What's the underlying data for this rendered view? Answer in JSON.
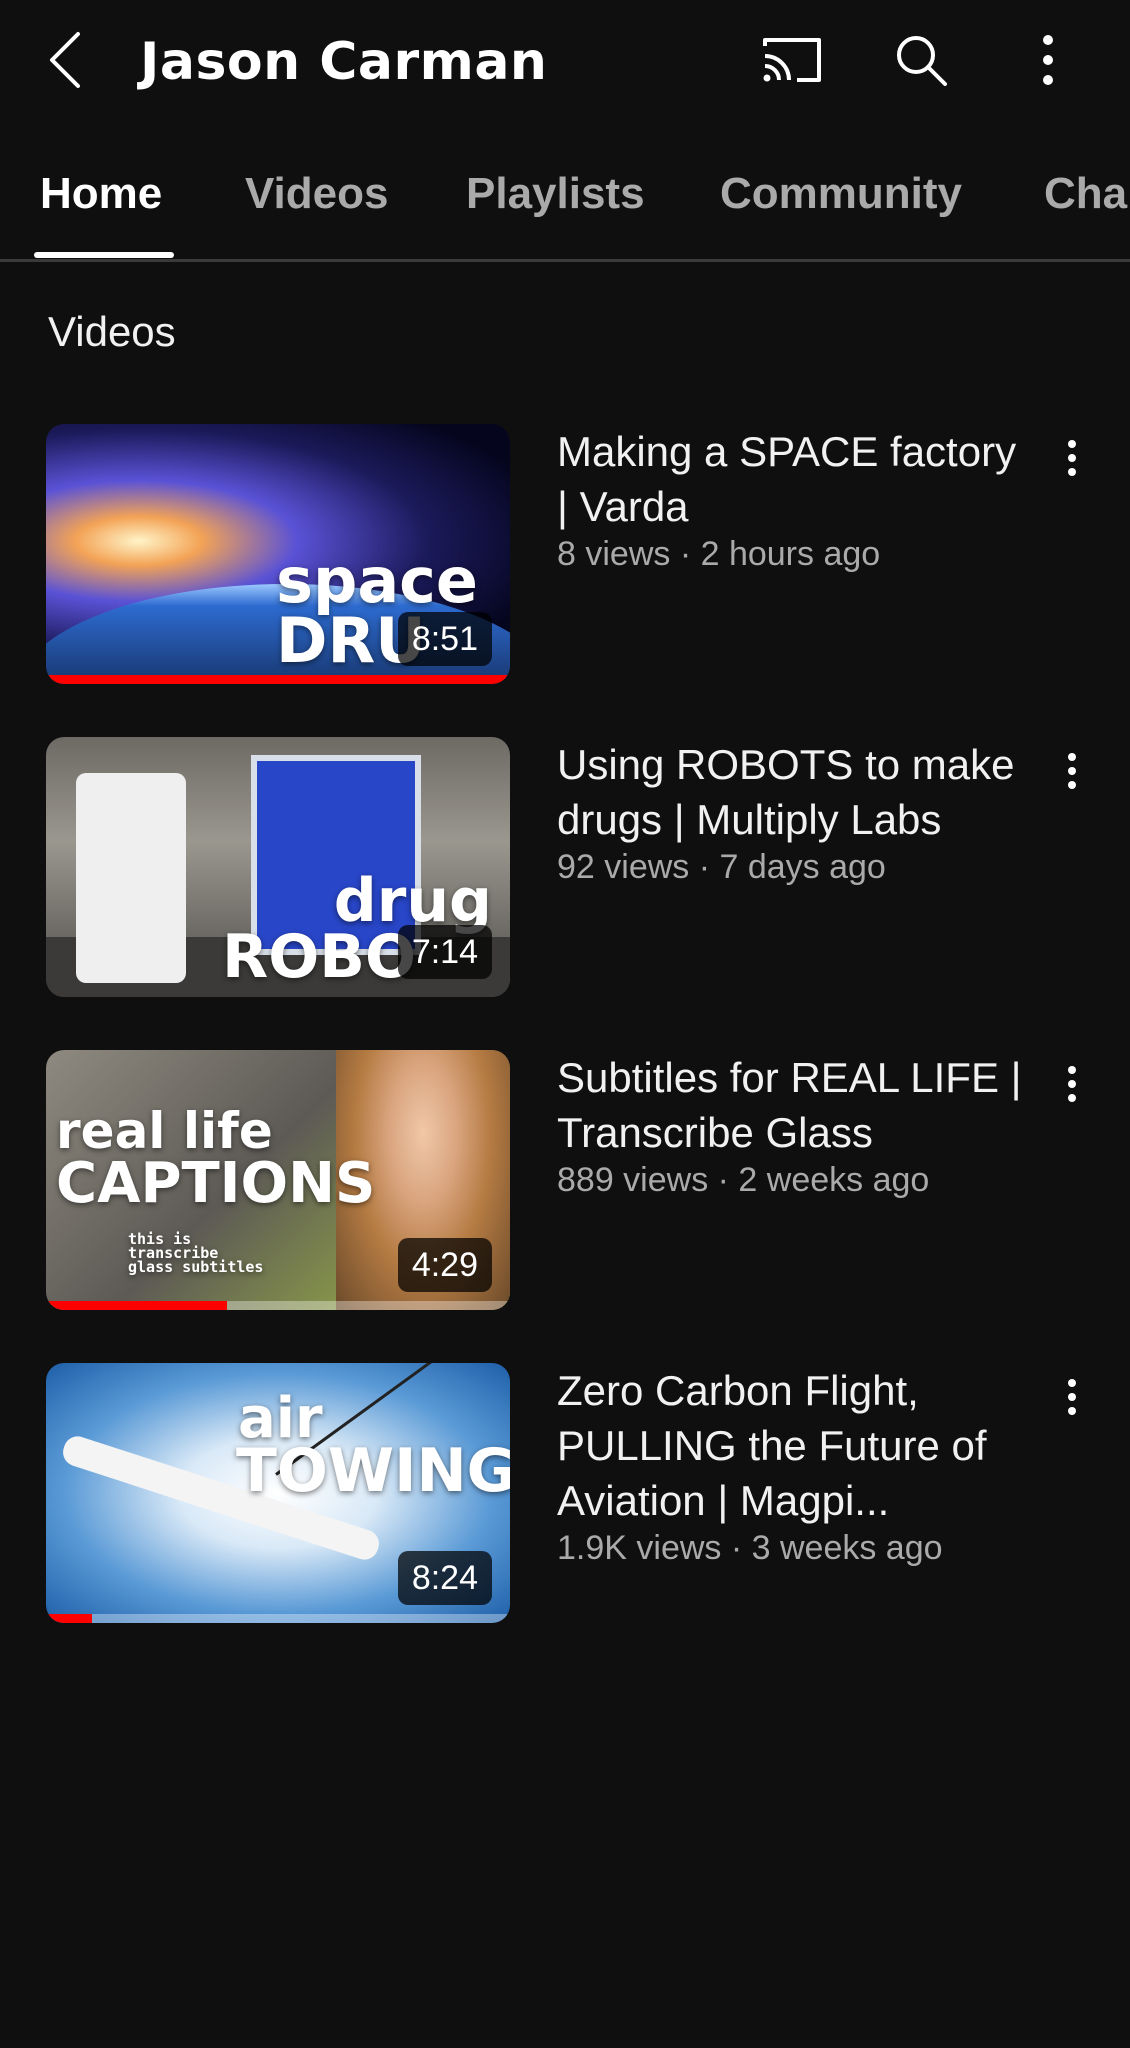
{
  "header": {
    "channel_name": "Jason Carman"
  },
  "tabs": [
    {
      "label": "Home",
      "active": true
    },
    {
      "label": "Videos",
      "active": false
    },
    {
      "label": "Playlists",
      "active": false
    },
    {
      "label": "Community",
      "active": false
    },
    {
      "label": "Cha",
      "active": false
    }
  ],
  "section": {
    "heading": "Videos"
  },
  "videos": [
    {
      "title": "Making a SPACE factory | Varda",
      "meta": "8 views · 2 hours ago",
      "duration": "8:51",
      "thumb_line1": "space",
      "thumb_line2": "DRU",
      "watched_fraction": 1.0
    },
    {
      "title": "Using ROBOTS to make drugs | Multiply Labs",
      "meta": "92 views · 7 days ago",
      "duration": "7:14",
      "thumb_line1": "drug",
      "thumb_line2": "ROBO",
      "watched_fraction": 0
    },
    {
      "title": "Subtitles for REAL LIFE | Transcribe Glass",
      "meta": "889 views · 2 weeks ago",
      "duration": "4:29",
      "thumb_line1": "real life",
      "thumb_line2": "CAPTIONS",
      "thumb_small": "this is transcribe glass subtitles",
      "watched_fraction": 0.39
    },
    {
      "title": "Zero Carbon Flight, PULLING the Future of Aviation | Magpi...",
      "meta": "1.9K views · 3 weeks ago",
      "duration": "8:24",
      "thumb_line1": "air",
      "thumb_line2": "TOWING",
      "watched_fraction": 0.1
    }
  ],
  "colors": {
    "background": "#0f0f0f",
    "progress": "#ff0000",
    "secondary_text": "#aaaaaa"
  }
}
